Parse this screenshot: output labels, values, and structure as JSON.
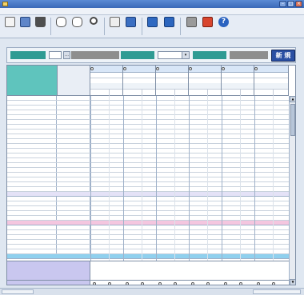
{
  "window": {
    "title": ""
  },
  "menu": [
    "",
    "",
    "",
    "",
    "",
    "",
    ""
  ],
  "toolbar": {
    "buttons": [
      {
        "label": "",
        "icon": "new-doc-icon",
        "color": "#f2f2f2"
      },
      {
        "label": "",
        "icon": "save-icon",
        "color": "#5f86c9"
      },
      {
        "label": "",
        "icon": "",
        "color": "#555555"
      },
      {
        "label": "",
        "icon": "",
        "color": "#6f6f6f"
      },
      {
        "label": "",
        "icon": "",
        "color": "#6f6f6f"
      },
      {
        "label": "",
        "icon": "search-icon",
        "color": "#ffffff"
      },
      {
        "label": "",
        "icon": "",
        "color": "#e6e6e6"
      },
      {
        "label": "",
        "icon": "",
        "color": "#3b6fc2"
      },
      {
        "label": "",
        "icon": "",
        "color": "#2f69c1"
      },
      {
        "label": "",
        "icon": "",
        "color": "#2d66be"
      },
      {
        "label": "",
        "icon": "print-icon",
        "color": "#8a8a8a"
      },
      {
        "label": "",
        "icon": "exit-icon",
        "color": "#d8452e"
      },
      {
        "label": "",
        "icon": "help-icon",
        "color": "#2b63c0"
      }
    ]
  },
  "prompt": "",
  "filter": {
    "user_label": "",
    "plan_date_label": "",
    "plan_creator_label": "",
    "new_button": "新 規"
  },
  "sheet": {
    "mid_header": [
      "",
      ""
    ],
    "groups": [
      {
        "top": "",
        "r2": "",
        "r3": "",
        "r4": "",
        "r5": [
          "",
          ""
        ]
      },
      {
        "top": "",
        "r2": "",
        "r3": "",
        "r4": "",
        "r5": [
          "",
          ""
        ]
      },
      {
        "top": "",
        "r2": "",
        "r3": "",
        "r4": "",
        "r5": [
          "",
          ""
        ]
      },
      {
        "top": "",
        "r2": "",
        "r3": "",
        "r4": "",
        "r5": [
          "",
          ""
        ]
      },
      {
        "top": "",
        "r2": "",
        "r3": "",
        "r4": "",
        "r5": [
          "",
          ""
        ]
      },
      {
        "top": "",
        "r2": "",
        "r3": "",
        "r4": "",
        "r5": [
          "",
          ""
        ]
      }
    ],
    "rows": [
      {
        "label": "",
        "type": "row"
      },
      {
        "label": "",
        "type": "row"
      },
      {
        "label": "",
        "type": "row"
      },
      {
        "label": "",
        "type": "row"
      },
      {
        "label": "",
        "type": "row"
      },
      {
        "label": "",
        "type": "row"
      },
      {
        "label": "",
        "type": "row"
      },
      {
        "label": "",
        "type": "row"
      },
      {
        "label": "",
        "type": "row"
      },
      {
        "label": "",
        "type": "row"
      },
      {
        "label": "",
        "type": "row"
      },
      {
        "label": "",
        "type": "row"
      },
      {
        "label": "",
        "type": "row"
      },
      {
        "label": "",
        "type": "row"
      },
      {
        "label": "",
        "type": "row"
      },
      {
        "label": "",
        "type": "row"
      },
      {
        "label": "",
        "type": "row"
      },
      {
        "label": "",
        "type": "row"
      },
      {
        "label": "",
        "type": "row"
      },
      {
        "label": "",
        "type": "row"
      },
      {
        "label": "",
        "type": "band",
        "color": "#e4e2f7"
      },
      {
        "label": "",
        "type": "row"
      },
      {
        "label": "",
        "type": "row"
      },
      {
        "label": "",
        "type": "row"
      },
      {
        "label": "",
        "type": "row"
      },
      {
        "label": "",
        "type": "row"
      },
      {
        "label": "",
        "type": "band",
        "color": "#f4c6df"
      },
      {
        "label": "",
        "type": "row"
      },
      {
        "label": "",
        "type": "row"
      },
      {
        "label": "",
        "type": "row"
      },
      {
        "label": "",
        "type": "row"
      },
      {
        "label": "",
        "type": "row"
      },
      {
        "label": "",
        "type": "row"
      },
      {
        "label": "",
        "type": "band",
        "color": "#8fd0ee"
      }
    ],
    "eval_label": "",
    "eval_bottom_label": "",
    "eval_options": [
      "",
      ""
    ]
  }
}
